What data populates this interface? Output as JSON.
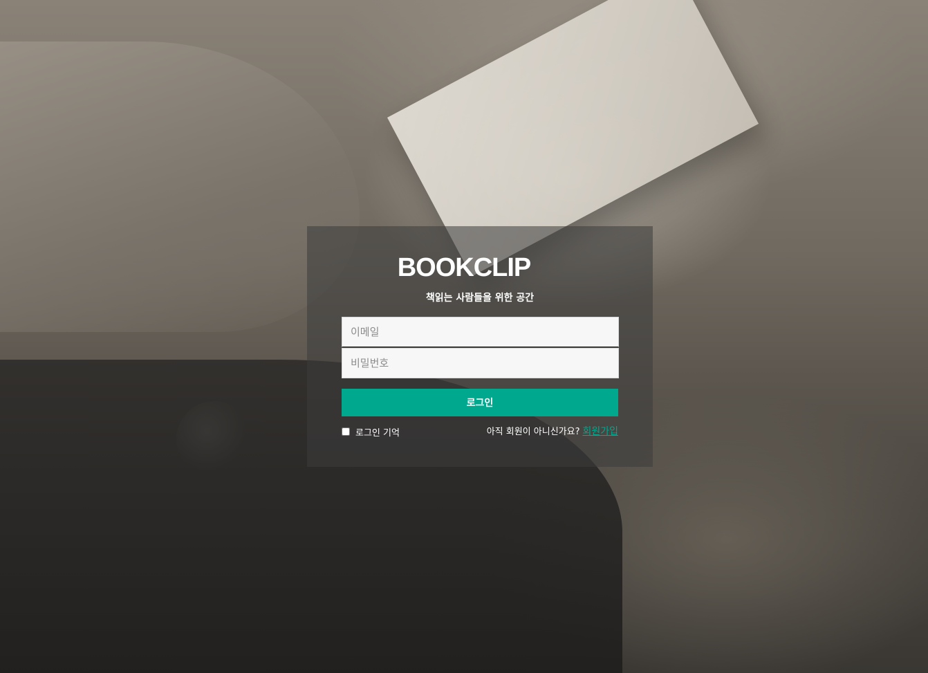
{
  "brand": {
    "title": "BOOKCLIP",
    "tagline": "책읽는 사람들을 위한 공간"
  },
  "form": {
    "email_placeholder": "이메일",
    "password_placeholder": "비밀번호",
    "login_label": "로그인",
    "remember_label": "로그인 기억",
    "signup_prompt": "아직 회원이 아니신가요?",
    "signup_link": "회원가입"
  },
  "colors": {
    "accent": "#00a88e",
    "panel": "rgba(60,60,60,0.55)"
  }
}
